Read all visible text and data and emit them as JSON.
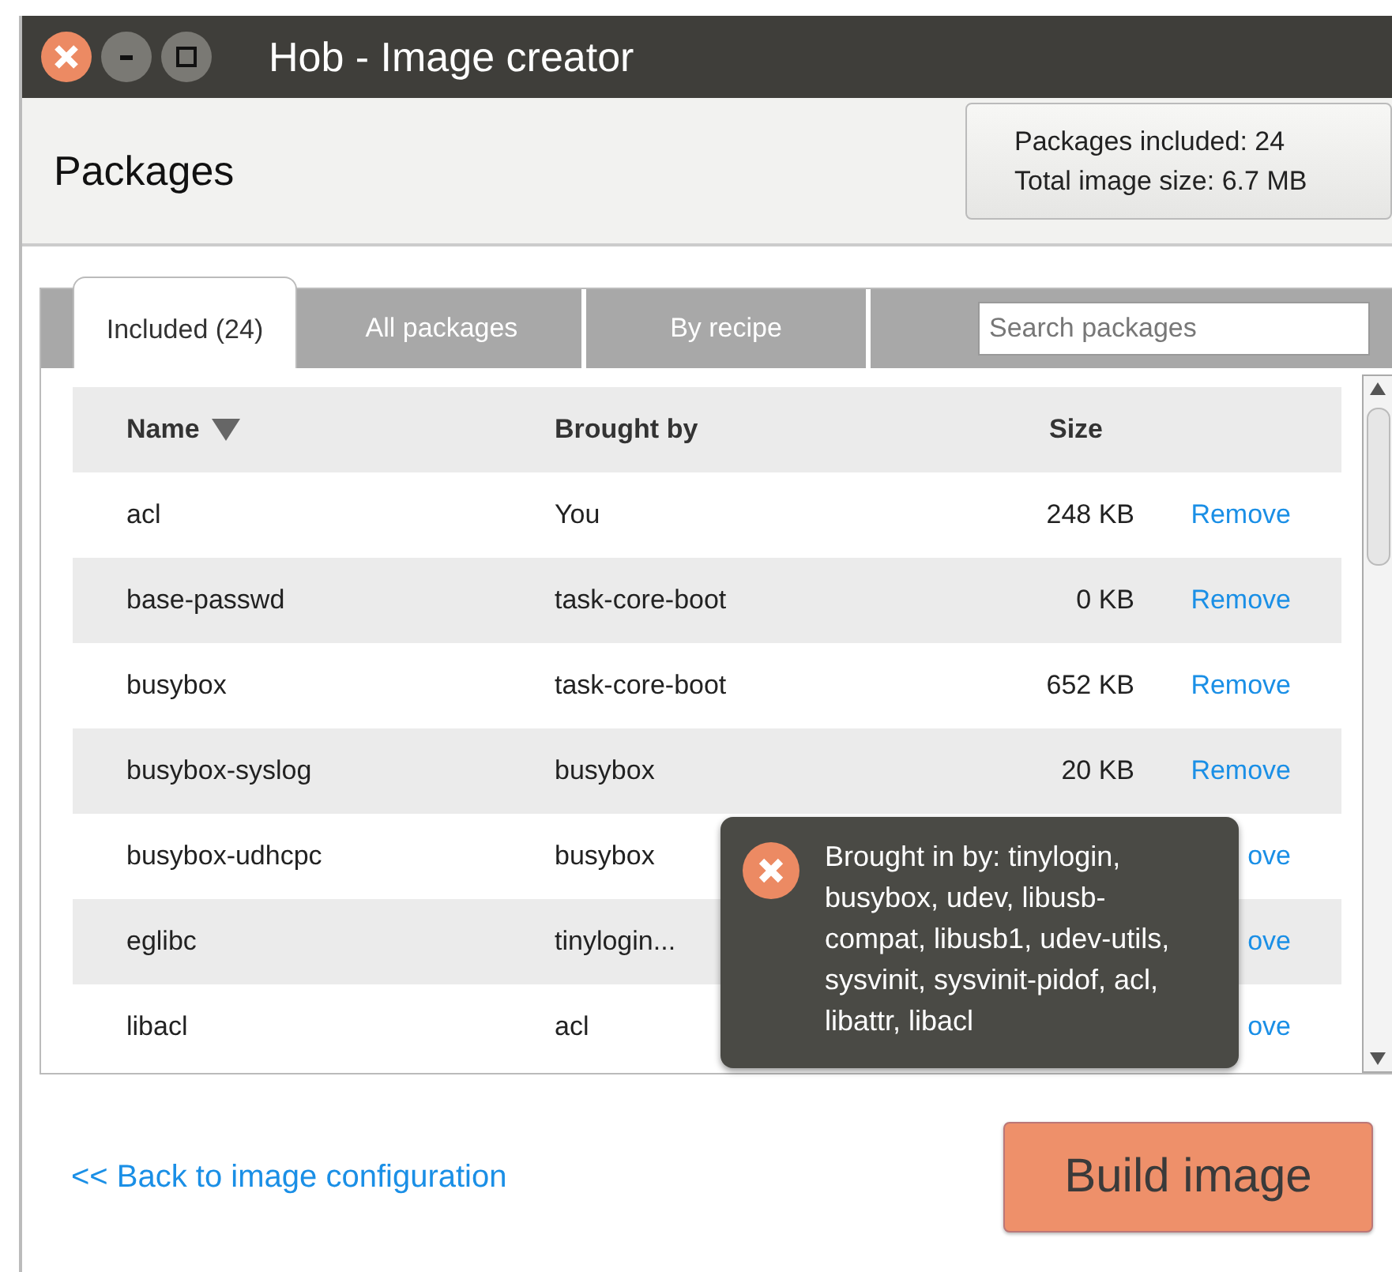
{
  "window": {
    "title": "Hob - Image creator"
  },
  "header": {
    "title": "Packages",
    "summary": [
      "Packages included: 24",
      "Total image size:  6.7 MB"
    ]
  },
  "tabs": [
    {
      "label": "Included (24)",
      "selected": true
    },
    {
      "label": "All packages",
      "selected": false
    },
    {
      "label": "By recipe",
      "selected": false
    }
  ],
  "search": {
    "placeholder": "Search packages"
  },
  "table": {
    "columns": [
      {
        "label": "Name",
        "sorted": true
      },
      {
        "label": "Brought by",
        "sorted": false
      },
      {
        "label": "Size",
        "sorted": false
      }
    ],
    "rows": [
      {
        "name": "acl",
        "brought_by": "You",
        "size": "248 KB",
        "action": "Remove"
      },
      {
        "name": "base-passwd",
        "brought_by": "task-core-boot",
        "size": "0 KB",
        "action": "Remove"
      },
      {
        "name": "busybox",
        "brought_by": "task-core-boot",
        "size": "652 KB",
        "action": "Remove"
      },
      {
        "name": "busybox-syslog",
        "brought_by": "busybox",
        "size": "20 KB",
        "action": "Remove"
      },
      {
        "name": "busybox-udhcpc",
        "brought_by": "busybox",
        "action": "ove"
      },
      {
        "name": "eglibc",
        "brought_by": "tinylogin...",
        "action": "ove"
      },
      {
        "name": "libacl",
        "brought_by": "acl",
        "action": "ove"
      }
    ]
  },
  "tooltip": {
    "text": "Brought in by: tinylogin, busybox, udev, libusb-compat, libusb1, udev-utils, sysvinit, sysvinit-pidof, acl, libattr, libacl"
  },
  "footer": {
    "back_link": "<< Back to image configuration",
    "build_button": "Build image"
  }
}
